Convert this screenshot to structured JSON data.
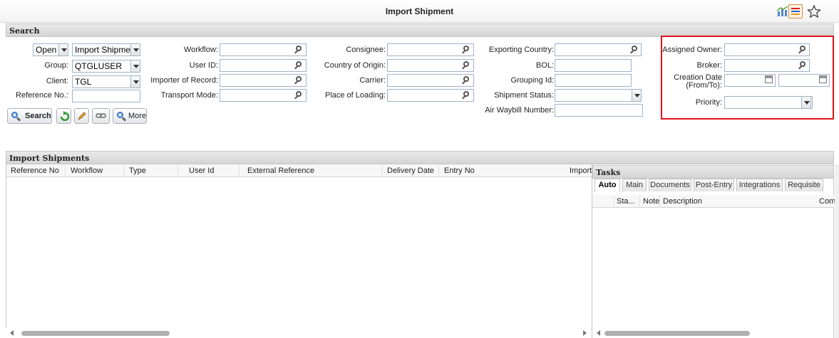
{
  "page": {
    "title": "Import Shipment"
  },
  "search": {
    "header": "Search",
    "status_value": "Open",
    "type_value": "Import Shipment",
    "group_label": "Group:",
    "group_value": "QTGLUSER",
    "client_label": "Client:",
    "client_value": "TGL",
    "reference_label": "Reference No.:",
    "reference_value": "",
    "workflow_label": "Workflow:",
    "userid_label": "User ID:",
    "ior_label": "Importer of Record:",
    "transport_label": "Transport Mode:",
    "consignee_label": "Consignee:",
    "origin_label": "Country of Origin:",
    "carrier_label": "Carrier:",
    "loading_label": "Place of Loading:",
    "exporting_label": "Exporting Country:",
    "bol_label": "BOL:",
    "grouping_label": "Grouping Id:",
    "status_label": "Shipment Status:",
    "awb_label": "Air Waybill Number:",
    "owner_label": "Assigned Owner:",
    "broker_label": "Broker:",
    "creation_label_1": "Creation Date",
    "creation_label_2": "(From/To):",
    "priority_label": "Priority:",
    "search_button": "Search",
    "more_button": "More"
  },
  "shipments": {
    "header": "Import Shipments",
    "columns": [
      "Reference No",
      "Workflow",
      "Type",
      "User Id",
      "External Reference",
      "Delivery Date",
      "Entry No",
      "Import"
    ]
  },
  "tasks": {
    "header": "Tasks",
    "tabs": [
      "Auto",
      "Main",
      "Documents",
      "Post-Entry",
      "Integrations",
      "Requisite"
    ],
    "columns": [
      "Sta...",
      "Note",
      "Description",
      "Com"
    ]
  },
  "colors": {
    "highlight": "#e0131a",
    "accent": "#3a78c4"
  }
}
